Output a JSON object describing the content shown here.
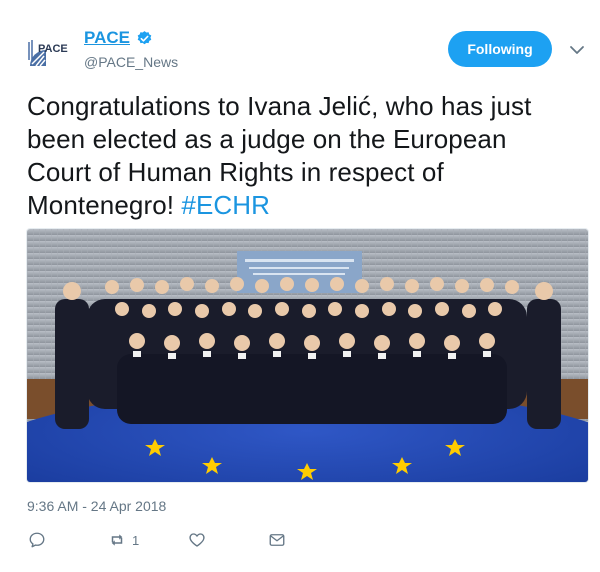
{
  "account": {
    "display_name": "PACE",
    "handle": "@PACE_News",
    "avatar_text": "PACE",
    "avatar_icon": "pace-logo-icon",
    "verified_icon": "verified-badge-icon"
  },
  "follow_button": {
    "label": "Following"
  },
  "menu": {
    "icon": "chevron-down-icon"
  },
  "tweet": {
    "text": "Congratulations to Ivana Jelić, who has just been elected as a judge on the European Court of Human Rights in respect of Montenegro!",
    "hashtag": "#ECHR",
    "photo_description_icon": "group-photo-icon",
    "timestamp": "9:36 AM - 24 Apr 2018"
  },
  "actions": {
    "reply_icon": "reply-icon",
    "retweet_icon": "retweet-icon",
    "retweet_count": "1",
    "like_icon": "heart-icon",
    "dm_icon": "envelope-icon"
  },
  "colors": {
    "accent": "#1da1f2",
    "link": "#1b95e0",
    "muted": "#657786",
    "flag_blue": "#1f3a93",
    "star": "#ffcc00"
  }
}
